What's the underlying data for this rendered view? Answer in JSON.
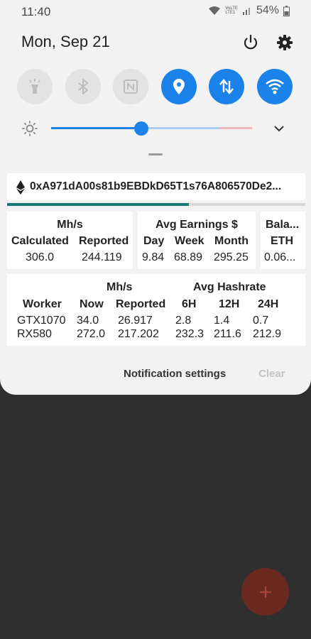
{
  "status": {
    "time": "11:40",
    "volte": [
      "VoLTE",
      "LTE1"
    ],
    "battery": "54%"
  },
  "header": {
    "date": "Mon, Sep 21"
  },
  "quick_settings": [
    {
      "icon": "flashlight-icon",
      "on": false
    },
    {
      "icon": "bluetooth-icon",
      "on": false
    },
    {
      "icon": "nfc-icon",
      "on": false
    },
    {
      "icon": "location-icon",
      "on": true
    },
    {
      "icon": "mobile-data-icon",
      "on": true
    },
    {
      "icon": "wifi-icon",
      "on": true
    }
  ],
  "brightness": {
    "level": 0.45
  },
  "colors": {
    "accent": "#1a82e8",
    "progress": "#167a72",
    "fab": "#6b2a20"
  },
  "notification": {
    "address": "0xA971dA00s81b9EBDkD65T1s76A806570De2...",
    "progress": 0.61,
    "hashrate_card": {
      "title": "Mh/s",
      "columns": [
        "Calculated",
        "Reported"
      ],
      "values": [
        "306.0",
        "244.119"
      ]
    },
    "earnings_card": {
      "title": "Avg Earnings $",
      "columns": [
        "Day",
        "Week",
        "Month"
      ],
      "values": [
        "9.84",
        "68.89",
        "295.25"
      ]
    },
    "balance_card": {
      "title": "Bala...",
      "unit": "ETH",
      "value": "0.06..."
    },
    "workers_card": {
      "mhs_title": "Mh/s",
      "avg_title": "Avg Hashrate",
      "columns": [
        "Worker",
        "Now",
        "Reported",
        "6H",
        "12H",
        "24H"
      ],
      "rows": [
        [
          "GTX1070",
          "34.0",
          "26.917",
          "2.8",
          "1.4",
          "0.7"
        ],
        [
          "RX580",
          "272.0",
          "217.202",
          "232.3",
          "211.6",
          "212.9"
        ]
      ]
    }
  },
  "actions": {
    "notification_settings": "Notification settings",
    "clear": "Clear"
  },
  "fab": {
    "label": "+"
  }
}
